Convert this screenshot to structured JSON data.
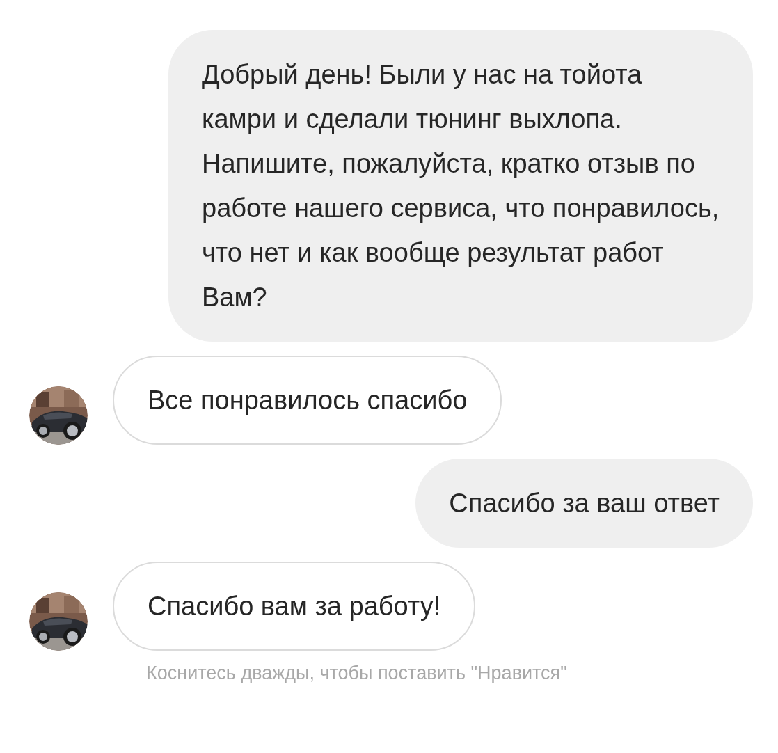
{
  "messages": [
    {
      "kind": "outgoing",
      "text": "Добрый день! Были у нас на тойота камри и сделали тюнинг выхлопа. Напишите, пожалуйста, кратко отзыв по работе нашего сервиса, что понравилось, что нет и как вообще результат работ Вам?"
    },
    {
      "kind": "incoming",
      "text": "Все понравилось спасибо"
    },
    {
      "kind": "outgoing",
      "text": "Спасибо за ваш ответ"
    },
    {
      "kind": "incoming",
      "text": "Спасибо вам за работу!"
    }
  ],
  "hint": "Коснитесь дважды, чтобы поставить \"Нравится\""
}
